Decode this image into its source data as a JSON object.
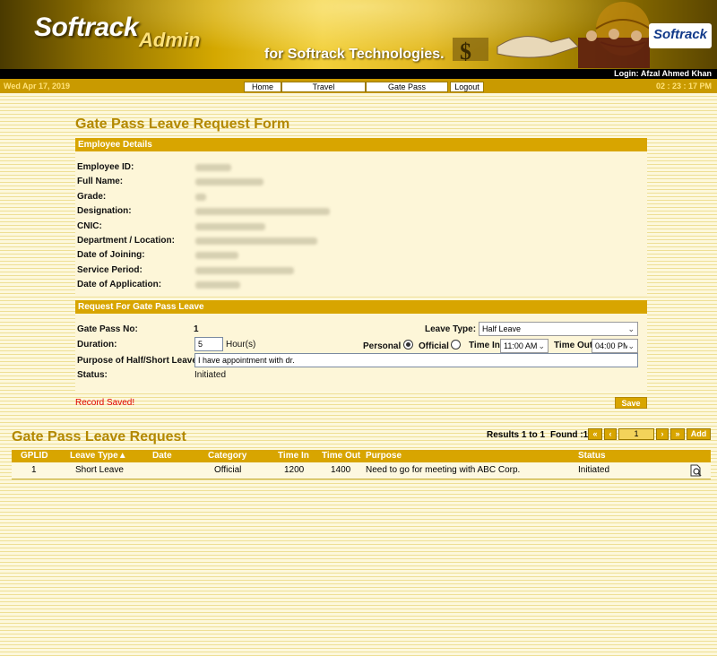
{
  "header": {
    "logo": "Softrack",
    "logo_suffix": "Admin",
    "tagline": "for Softrack Technologies.",
    "corner_logo": "Softrack",
    "login": "Login: Afzal Ahmed Khan",
    "date": "Wed Apr 17, 2019",
    "time": "02 : 23 : 17 PM"
  },
  "nav": {
    "items": [
      "Home",
      "Travel",
      "Gate Pass",
      "Logout"
    ]
  },
  "form": {
    "title": "Gate Pass Leave Request Form",
    "employee_section": "Employee Details",
    "employee_labels": [
      "Employee ID:",
      "Full Name:",
      "Grade:",
      "Designation:",
      "CNIC:",
      "Department / Location:",
      "Date of Joining:",
      "Service Period:",
      "Date of Application:"
    ],
    "request_section": "Request For Gate Pass Leave",
    "gate_pass_no_label": "Gate Pass No:",
    "gate_pass_no": "1",
    "duration_label": "Duration:",
    "duration_value": "5",
    "duration_unit": "Hour(s)",
    "purpose_label": "Purpose of Half/Short Leave:",
    "purpose_value": "I have appointment with dr.",
    "status_label": "Status:",
    "status_value": "Initiated",
    "leave_type_label": "Leave Type:",
    "leave_type_value": "Half Leave",
    "personal_label": "Personal",
    "official_label": "Official",
    "time_in_label": "Time In",
    "time_in_value": "11:00 AM",
    "time_out_label": "Time Out",
    "time_out_value": "04:00 PM",
    "record_saved": "Record Saved!",
    "save": "Save"
  },
  "list": {
    "title": "Gate Pass Leave Request",
    "results": "Results 1 to 1",
    "found": "Found :1",
    "page": "1",
    "add": "Add",
    "columns": [
      "GPLID",
      "Leave Type▲",
      "Date",
      "Category",
      "Time In",
      "Time Out",
      "Purpose",
      "Status"
    ],
    "rows": [
      {
        "gplid": "1",
        "leave_type": "Short Leave",
        "date": "",
        "category": "Official",
        "time_in": "1200",
        "time_out": "1400",
        "purpose": "Need to go for meeting with ABC Corp.",
        "status": "Initiated"
      }
    ]
  },
  "colors": {
    "accent": "#d8a500",
    "title": "#b38800",
    "error": "#e00000"
  }
}
